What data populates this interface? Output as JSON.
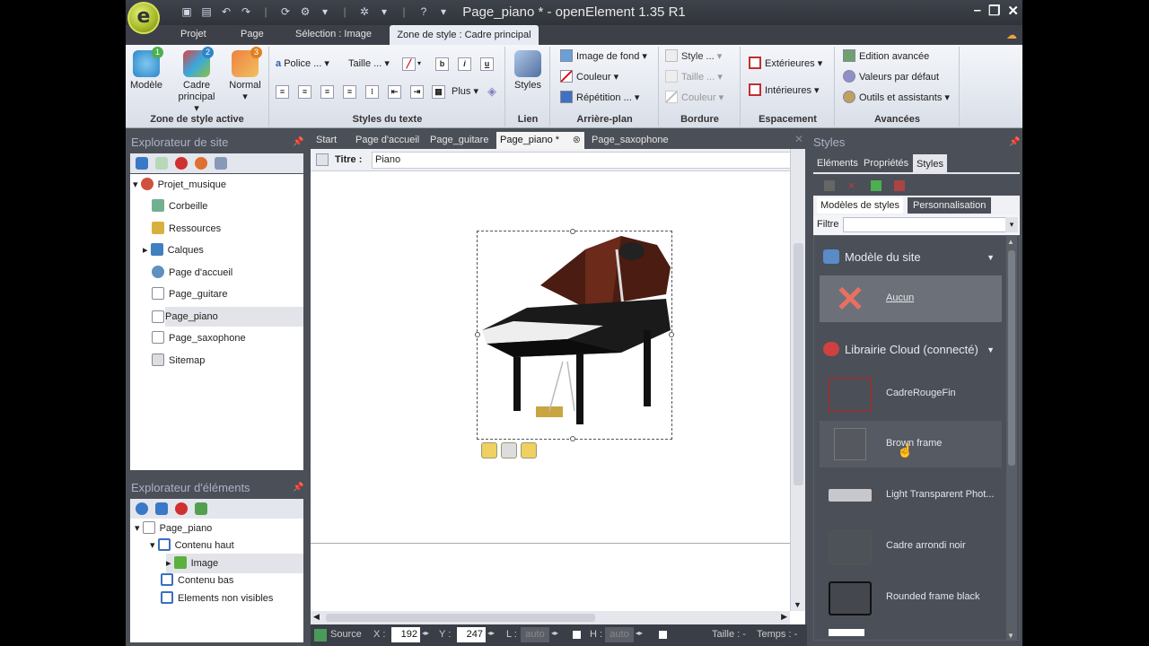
{
  "window": {
    "title": "Page_piano * - openElement 1.35 R1",
    "logo_letter": "e"
  },
  "ribbon_tabs": [
    "Projet",
    "Page",
    "Sélection : Image",
    "Zone de style : Cadre principal"
  ],
  "ribbon": {
    "zone": {
      "label": "Zone de style active",
      "modele": "Modèle",
      "cadre_line1": "Cadre",
      "cadre_line2": "principal",
      "normal": "Normal",
      "badge1": "1",
      "badge2": "2",
      "badge3": "3"
    },
    "texte": {
      "label": "Styles du texte",
      "police": "Police ...",
      "taille": "Taille ...",
      "bold": "b",
      "italic": "i",
      "underline": "u",
      "plus": "Plus"
    },
    "lien": {
      "label": "Lien",
      "styles": "Styles"
    },
    "arriere": {
      "label": "Arrière-plan",
      "image": "Image de fond",
      "couleur": "Couleur",
      "repetition": "Répétition ..."
    },
    "bordure": {
      "label": "Bordure",
      "style": "Style ...",
      "taille": "Taille ...",
      "couleur": "Couleur"
    },
    "espacement": {
      "label": "Espacement",
      "ext": "Extérieures",
      "int": "Intérieures"
    },
    "avancees": {
      "label": "Avancées",
      "edition": "Edition avancée",
      "valeurs": "Valeurs par défaut",
      "outils": "Outils et assistants"
    }
  },
  "site_explorer": {
    "title": "Explorateur de site",
    "items": [
      "Projet_musique",
      "Corbeille",
      "Ressources",
      "Calques",
      "Page d'accueil",
      "Page_guitare",
      "Page_piano",
      "Page_saxophone",
      "Sitemap"
    ],
    "selected": "Page_piano"
  },
  "element_explorer": {
    "title": "Explorateur d'éléments",
    "items": [
      "Page_piano",
      "Contenu haut",
      "Image",
      "Contenu bas",
      "Elements non visibles"
    ],
    "selected": "Image"
  },
  "doc_tabs": [
    "Start",
    "Page d'accueil",
    "Page_guitare",
    "Page_piano *",
    "Page_saxophone"
  ],
  "active_doc_tab": "Page_piano *",
  "title_field": {
    "label": "Titre :",
    "value": "Piano"
  },
  "status": {
    "source": "Source",
    "x_label": "X :",
    "x": "192",
    "y_label": "Y :",
    "y": "247",
    "l_label": "L :",
    "l": "auto",
    "h_label": "H :",
    "h": "auto",
    "taille": "Taille : -",
    "temps": "Temps : -"
  },
  "styles_panel": {
    "title": "Styles",
    "tabs": [
      "Eléments",
      "Propriétés",
      "Styles"
    ],
    "subtabs": [
      "Modèles de styles",
      "Personnalisation"
    ],
    "filter_label": "Filtre",
    "section1": "Modèle du site",
    "aucun": "Aucun",
    "section2": "Librairie Cloud (connecté)",
    "items": [
      "CadreRougeFin",
      "Brown frame",
      "Light Transparent Phot...",
      "Cadre arrondi noir",
      "Rounded frame black"
    ]
  },
  "colors": {
    "accent": "#a4b826",
    "panel": "#4b4f57",
    "ribbon_tab_active": "#e7ecf4"
  }
}
